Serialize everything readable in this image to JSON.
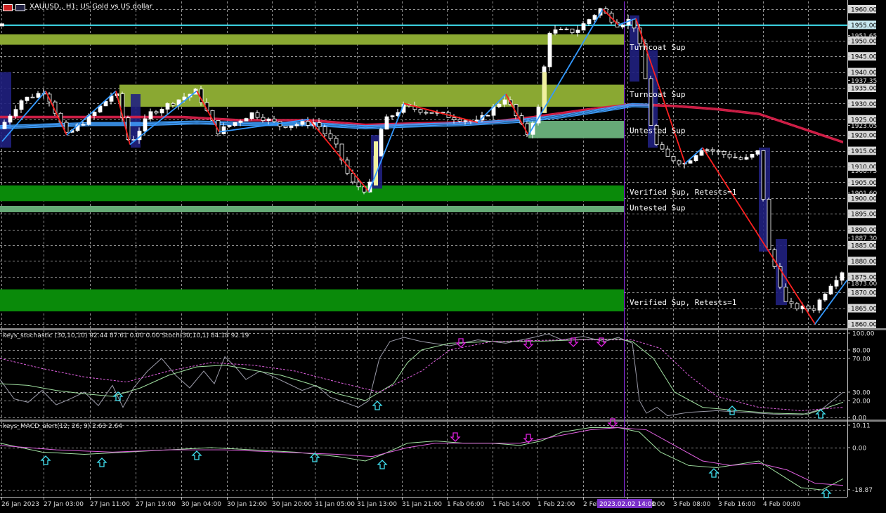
{
  "window": {
    "title": "XAUUSD., H1:  US Gold vs US dollar"
  },
  "colors": {
    "background": "#000000",
    "grid": "#c0c0c0",
    "bull": "#ffffff",
    "bear": "#000000",
    "sup_olive": "#8aa832",
    "sup_green": "#0a8a0a",
    "sup_light": "#66aa77",
    "zigzag_blue": "#3399ff",
    "zigzag_red": "#ff2020",
    "ma_red": "#d8204a",
    "ma_blue": "#40a0ff",
    "cyan_line": "#40e0f0",
    "blue_box": "#202080",
    "vline": "#8a2be2",
    "stoch_main": "#9a9aa8",
    "stoch_signal": "#a0e0a0",
    "macd_main": "#a0e0a0",
    "macd_signal": "#e060e0",
    "arrow_up": "#40e0f0",
    "arrow_down": "#e020e0"
  },
  "price_axis": {
    "levels": [
      "1960.00",
      "1955.00",
      "1951.65",
      "1950.00",
      "1945.00",
      "1940.00",
      "1937.35",
      "1935.00",
      "1930.00",
      "1925.00",
      "1923.05",
      "1920.00",
      "1915.00",
      "1910.00",
      "1908.75",
      "1905.00",
      "1901.60",
      "1900.00",
      "1895.00",
      "1890.00",
      "1887.30",
      "1885.00",
      "1880.00",
      "1875.00",
      "1873.00",
      "1870.00",
      "1865.00",
      "1860.00"
    ],
    "current_price": "1955.00"
  },
  "zones": [
    {
      "label": "Turncoat Sup"
    },
    {
      "label": "Turncoat Sup"
    },
    {
      "label": "Untested Sup"
    },
    {
      "label": "Verified Sup, Retests=1"
    },
    {
      "label": "Untested Sup"
    },
    {
      "label": "Verified Sup, Retests=1"
    }
  ],
  "stochastic": {
    "title": "keys_stochastic (30,10,10) 92.44 87.61 0.00 0.00 Stoch(30,10,1) 84.18 92.19",
    "levels": [
      "100.00",
      "80.00",
      "70.00",
      "30.00",
      "20.00",
      "0.00"
    ]
  },
  "macd": {
    "title": "keys_MACD_alert(12, 26, 9) 2.63 2.64",
    "levels": [
      "10.11",
      "0.00",
      "-18.87"
    ]
  },
  "time_axis": {
    "labels": [
      "26 Jan 2023",
      "27 Jan 03:00",
      "27 Jan 11:00",
      "27 Jan 19:00",
      "30 Jan 04:00",
      "30 Jan 12:00",
      "30 Jan 20:00",
      "31 Jan 05:00",
      "31 Jan 13:00",
      "31 Jan 21:00",
      "1 Feb 06:00",
      "1 Feb 14:00",
      "1 Feb 22:00",
      "2 Feb",
      "2 Feb 23:00",
      "3 Feb 08:00",
      "3 Feb 16:00",
      "4 Feb 00:00"
    ],
    "cursor_label": "2023.02.02 14:00"
  }
}
